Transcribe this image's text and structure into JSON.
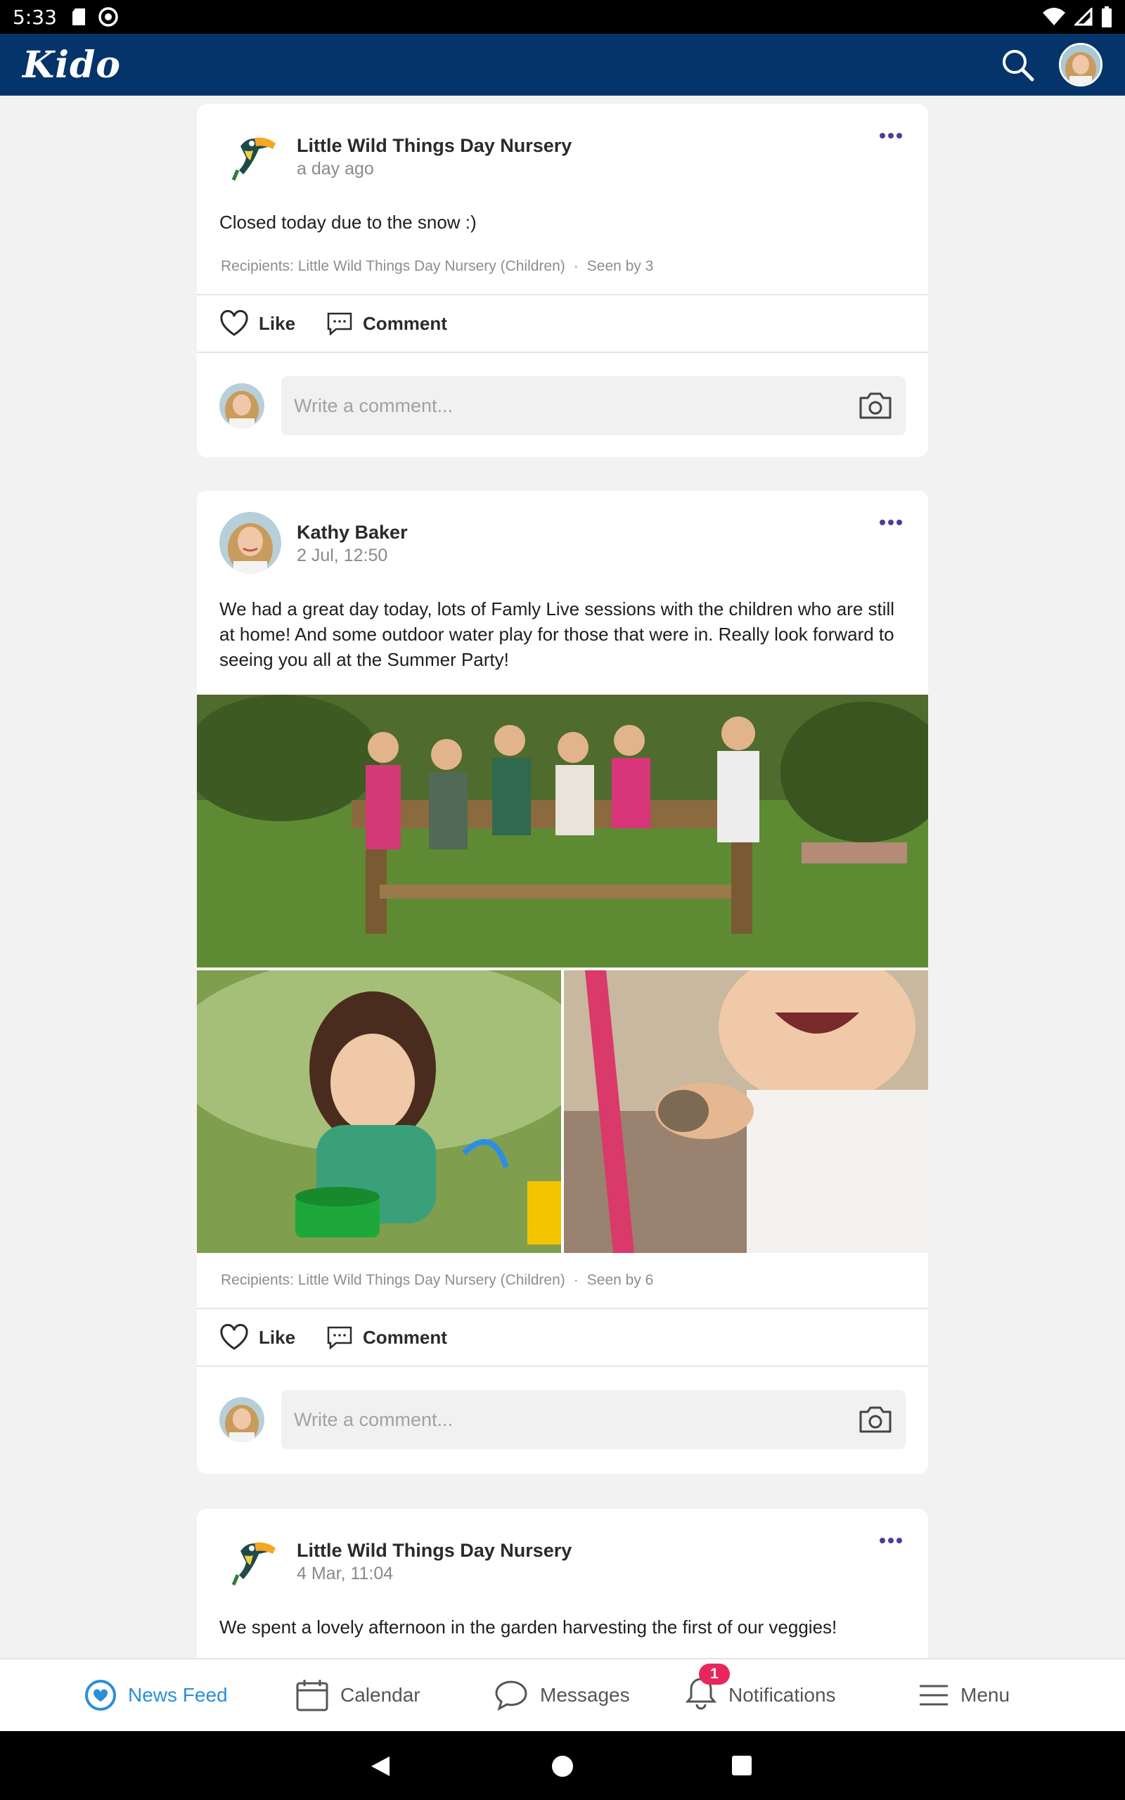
{
  "status_bar": {
    "time": "5:33"
  },
  "app": {
    "logo": "Kido"
  },
  "posts": [
    {
      "author": "Little Wild Things Day Nursery",
      "time": "a day ago",
      "text": "Closed today due to the snow :)",
      "recipients": "Recipients: Little Wild Things Day Nursery (Children)",
      "seen": "Seen by 3",
      "like_label": "Like",
      "comment_label": "Comment",
      "comment_placeholder": "Write a comment..."
    },
    {
      "author": "Kathy Baker",
      "time": "2 Jul, 12:50",
      "text": "We had a great day today, lots of Famly Live sessions with the children who are still at home! And some outdoor water play for those that were in. Really look forward to seeing you all at the Summer Party!",
      "recipients": "Recipients: Little Wild Things Day Nursery (Children)",
      "seen": "Seen by 6",
      "like_label": "Like",
      "comment_label": "Comment",
      "comment_placeholder": "Write a comment..."
    },
    {
      "author": "Little Wild Things Day Nursery",
      "time": "4 Mar, 11:04",
      "text": "We spent a lovely afternoon in the garden harvesting the first of our veggies!"
    }
  ],
  "bottom_nav": {
    "items": [
      {
        "label": "News Feed",
        "icon": "news-feed-icon"
      },
      {
        "label": "Calendar",
        "icon": "calendar-icon"
      },
      {
        "label": "Messages",
        "icon": "messages-icon"
      },
      {
        "label": "Notifications",
        "icon": "bell-icon",
        "badge": "1"
      },
      {
        "label": "Menu",
        "icon": "menu-icon"
      }
    ]
  },
  "colors": {
    "app_bar": "#05346a",
    "accent": "#2a8fd9",
    "menu_dots": "#4a3d9c",
    "badge": "#e8265d"
  }
}
